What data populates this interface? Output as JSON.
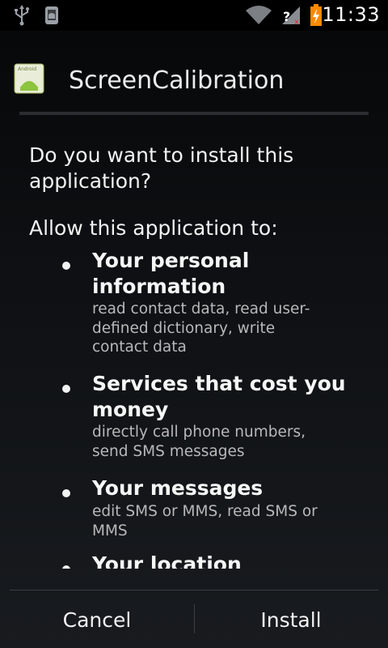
{
  "status_bar": {
    "time": "11:33",
    "icons": [
      "usb-icon",
      "android-debug-icon",
      "wifi-icon",
      "no-sim-icon",
      "battery-charging-icon"
    ],
    "accent": "#ff8a00"
  },
  "dialog": {
    "app_name": "ScreenCalibration",
    "app_icon_label": "Android",
    "question": "Do you want to install this application?",
    "allow_label": "Allow this application to:",
    "permissions": [
      {
        "title": "Your personal information",
        "desc": "read contact data, read user-defined dictionary, write contact data"
      },
      {
        "title": "Services that cost you money",
        "desc": "directly call phone numbers, send SMS messages"
      },
      {
        "title": "Your messages",
        "desc": "edit SMS or MMS, read SMS or MMS"
      },
      {
        "title": "Your location",
        "desc": ""
      }
    ]
  },
  "buttons": {
    "cancel": "Cancel",
    "install": "Install"
  }
}
